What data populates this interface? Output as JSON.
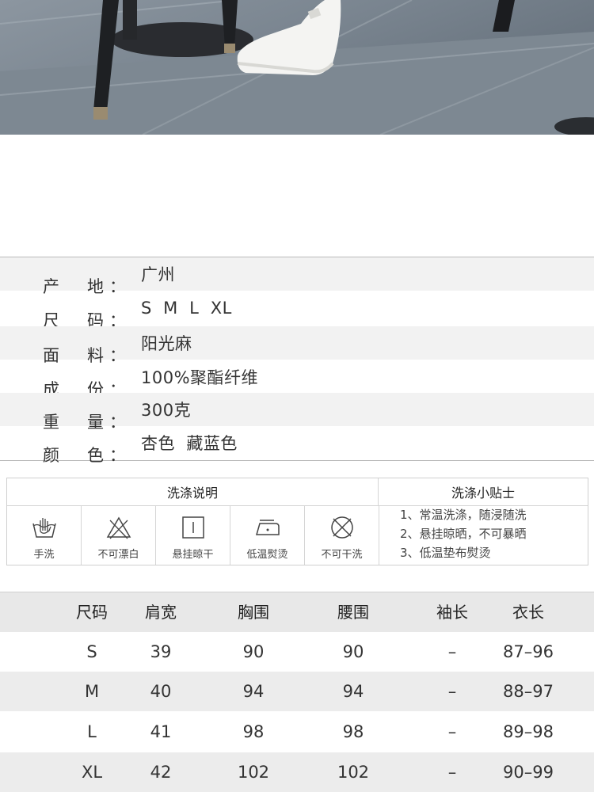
{
  "colors": {
    "row_alt": "#f2f2f2",
    "table_head": "#e8e8e8",
    "border": "#cfcfcf",
    "text": "#333333"
  },
  "product_info": [
    {
      "label_1": "产",
      "label_2": "地",
      "value": "广州"
    },
    {
      "label_1": "尺",
      "label_2": "码",
      "value": "S  M  L  XL"
    },
    {
      "label_1": "面",
      "label_2": "料",
      "value": "阳光麻"
    },
    {
      "label_1": "成",
      "label_2": "份",
      "value": "100%聚酯纤维"
    },
    {
      "label_1": "重",
      "label_2": "量",
      "value": "300克"
    },
    {
      "label_1": "颜",
      "label_2": "色",
      "value": "杏色  藏蓝色"
    }
  ],
  "colon": "：",
  "wash": {
    "title": "洗涤说明",
    "tips_title": "洗涤小贴士",
    "icons": [
      {
        "icon": "hand-wash-icon",
        "label": "手洗"
      },
      {
        "icon": "no-bleach-icon",
        "label": "不可漂白"
      },
      {
        "icon": "hang-dry-icon",
        "label": "悬挂晾干"
      },
      {
        "icon": "low-iron-icon",
        "label": "低温熨烫"
      },
      {
        "icon": "no-dry-clean-icon",
        "label": "不可干洗"
      }
    ],
    "tips": [
      "1、常温洗涤，随浸随洗",
      "2、悬挂晾晒，不可暴晒",
      "3、低温垫布熨烫"
    ]
  },
  "size_table": {
    "headers": [
      "尺码",
      "肩宽",
      "胸围",
      "腰围",
      "袖长",
      "衣长"
    ],
    "rows": [
      [
        "S",
        "39",
        "90",
        "90",
        "–",
        "87–96"
      ],
      [
        "M",
        "40",
        "94",
        "94",
        "–",
        "88–97"
      ],
      [
        "L",
        "41",
        "98",
        "98",
        "–",
        "89–98"
      ],
      [
        "XL",
        "42",
        "102",
        "102",
        "–",
        "90–99"
      ]
    ]
  }
}
